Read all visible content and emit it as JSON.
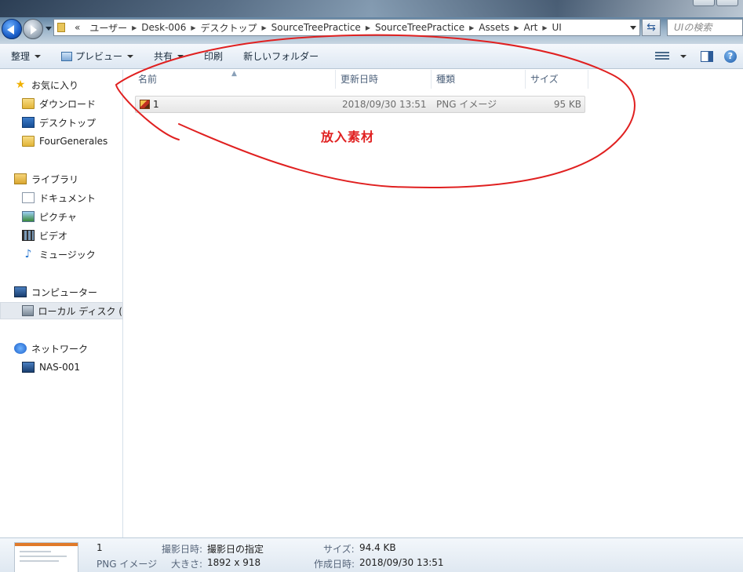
{
  "window": {
    "search_placeholder": "UIの検索"
  },
  "address": {
    "prefix": "«",
    "crumbs": [
      "ユーザー",
      "Desk-006",
      "デスクトップ",
      "SourceTreePractice",
      "SourceTreePractice",
      "Assets",
      "Art",
      "UI"
    ]
  },
  "toolbar": {
    "organize": "整理",
    "preview": "プレビュー",
    "share": "共有",
    "print": "印刷",
    "new_folder": "新しいフォルダー"
  },
  "sidebar": {
    "favorites": "お気に入り",
    "downloads": "ダウンロード",
    "desktop": "デスクトップ",
    "fourgenerales": "FourGenerales",
    "libraries": "ライブラリ",
    "documents": "ドキュメント",
    "pictures": "ピクチャ",
    "videos": "ビデオ",
    "music": "ミュージック",
    "computer": "コンピューター",
    "local_disk": "ローカル ディスク (",
    "network": "ネットワーク",
    "nas": "NAS-001"
  },
  "columns": {
    "name": "名前",
    "modified": "更新日時",
    "type": "種類",
    "size": "サイズ"
  },
  "files": [
    {
      "name": "1",
      "modified": "2018/09/30 13:51",
      "type": "PNG イメージ",
      "size": "95 KB"
    }
  ],
  "annotation": {
    "text": "放入素材",
    "color": "#e02020"
  },
  "details": {
    "name": "1",
    "type": "PNG イメージ",
    "date_taken_label": "撮影日時:",
    "date_taken_value": "撮影日の指定",
    "dimensions_label": "大きさ:",
    "dimensions_value": "1892 x 918",
    "size_label": "サイズ:",
    "size_value": "94.4 KB",
    "created_label": "作成日時:",
    "created_value": "2018/09/30 13:51"
  }
}
